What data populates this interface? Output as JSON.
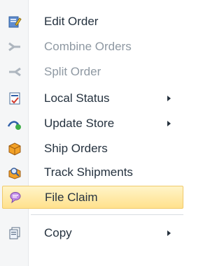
{
  "menu": {
    "items": [
      {
        "label": "Edit Order",
        "icon": "edit-order-icon",
        "enabled": true
      },
      {
        "label": "Combine Orders",
        "icon": "combine-orders-icon",
        "enabled": false
      },
      {
        "label": "Split Order",
        "icon": "split-order-icon",
        "enabled": false
      },
      {
        "label": "Local Status",
        "icon": "local-status-icon",
        "enabled": true,
        "submenu": true
      },
      {
        "label": "Update Store",
        "icon": "update-store-icon",
        "enabled": true,
        "submenu": true
      },
      {
        "label": "Ship Orders",
        "icon": "ship-orders-icon",
        "enabled": true
      },
      {
        "label": "Track Shipments",
        "icon": "track-shipments-icon",
        "enabled": true
      },
      {
        "label": "File Claim",
        "icon": "file-claim-icon",
        "enabled": true,
        "highlighted": true
      },
      {
        "label": "Copy",
        "icon": "copy-icon",
        "enabled": true,
        "submenu": true
      }
    ]
  },
  "colors": {
    "highlight": "#ffe18d",
    "text": "#25323f",
    "disabled_text": "#8e98a2"
  }
}
